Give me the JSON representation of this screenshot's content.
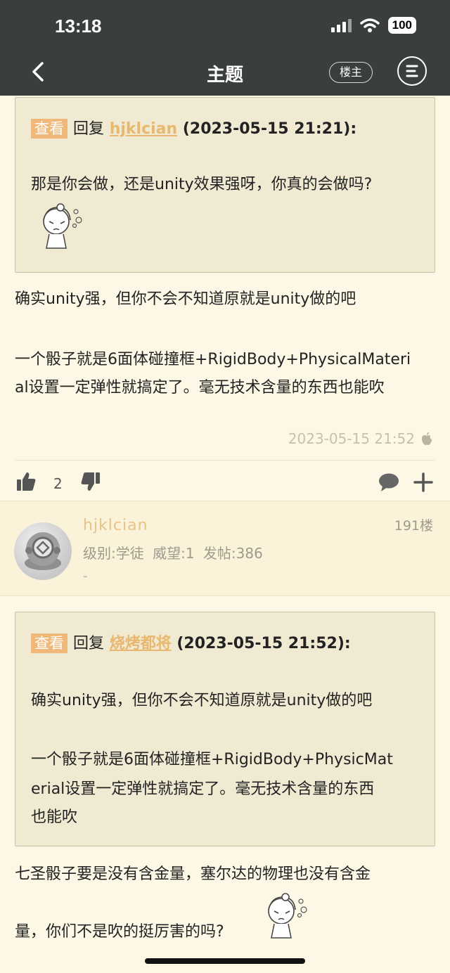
{
  "status_bar": {
    "time": "13:18",
    "battery": "100"
  },
  "nav": {
    "title": "主题",
    "author_only_label": "楼主"
  },
  "post1": {
    "quote": {
      "view_tag": "查看",
      "reply_word": "回复",
      "user": "hjklcian",
      "datetime": "(2023-05-15 21:21):",
      "text": "那是你会做，还是unity效果强呀，你真的会做吗?"
    },
    "paragraph1": "确实unity强，但你不会不知道原就是unity做的吧",
    "paragraph2_line1": "一个骰子就是6面体碰撞框+RigidBody+PhysicalMateri",
    "paragraph2_line2": "al设置一定弹性就搞定了。毫无技术含量的东西也能吹",
    "timestamp": "2023-05-15 21:52",
    "like_count": "2"
  },
  "post2": {
    "user": {
      "name": "hjklcian",
      "stats": "级别:学徒  威望:1  发帖:386",
      "signature": "-",
      "floor": "191楼"
    },
    "quote": {
      "view_tag": "查看",
      "reply_word": "回复",
      "user": "烧烤都将",
      "datetime": "(2023-05-15 21:52):",
      "line1": "确实unity强，但你不会不知道原就是unity做的吧",
      "line2": "一个骰子就是6面体碰撞框+RigidBody+PhysicMat",
      "line3": "erial设置一定弹性就搞定了。毫无技术含量的东西",
      "line4": "也能吹"
    },
    "line1": "七圣骰子要是没有含金量，塞尔达的物理也没有含金",
    "line2": "量，你们不是吹的挺厉害的吗?"
  },
  "icons": [
    "back-icon",
    "menu-icon",
    "thumbs-up-icon",
    "thumbs-down-icon",
    "comment-icon",
    "add-icon",
    "apple-icon",
    "signal-icon",
    "wifi-icon",
    "battery-icon"
  ]
}
